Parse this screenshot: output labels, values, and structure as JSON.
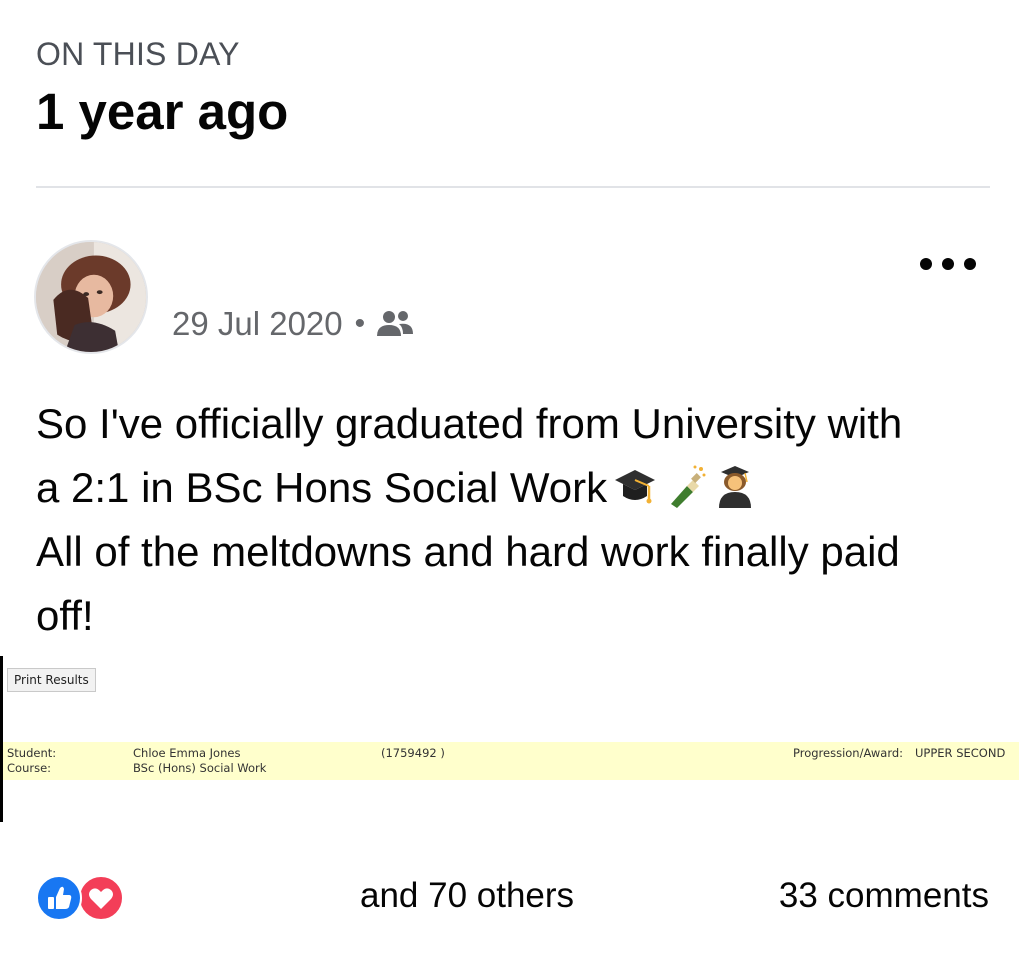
{
  "header": {
    "label": "ON THIS DAY",
    "title": "1 year ago"
  },
  "post": {
    "date": "29 Jul 2020",
    "separator": "•",
    "audience_icon": "friends-icon",
    "more_icon": "more-options-icon",
    "text_lines": [
      "So I've officially graduated from University with",
      "a 2:1 in BSc Hons Social Work",
      "All of the meltdowns and hard work finally paid",
      "off!"
    ],
    "emojis": [
      "graduation-cap-emoji",
      "champagne-emoji",
      "woman-student-emoji"
    ]
  },
  "attachment": {
    "print_button": "Print Results",
    "student_label": "Student:",
    "course_label": "Course:",
    "student_name": "Chloe Emma Jones",
    "course_name": "BSc (Hons) Social Work",
    "student_id": "(1759492 )",
    "award_label": "Progression/Award:",
    "award_value": "UPPER SECOND",
    "highlight_color": "#ffffcc"
  },
  "footer": {
    "reactions": [
      "like-reaction-icon",
      "love-reaction-icon"
    ],
    "reaction_count": "and 70 others",
    "comments": "33 comments"
  },
  "colors": {
    "like": "#1877f2",
    "love": "#f33e58",
    "secondary_text": "#65676b"
  }
}
